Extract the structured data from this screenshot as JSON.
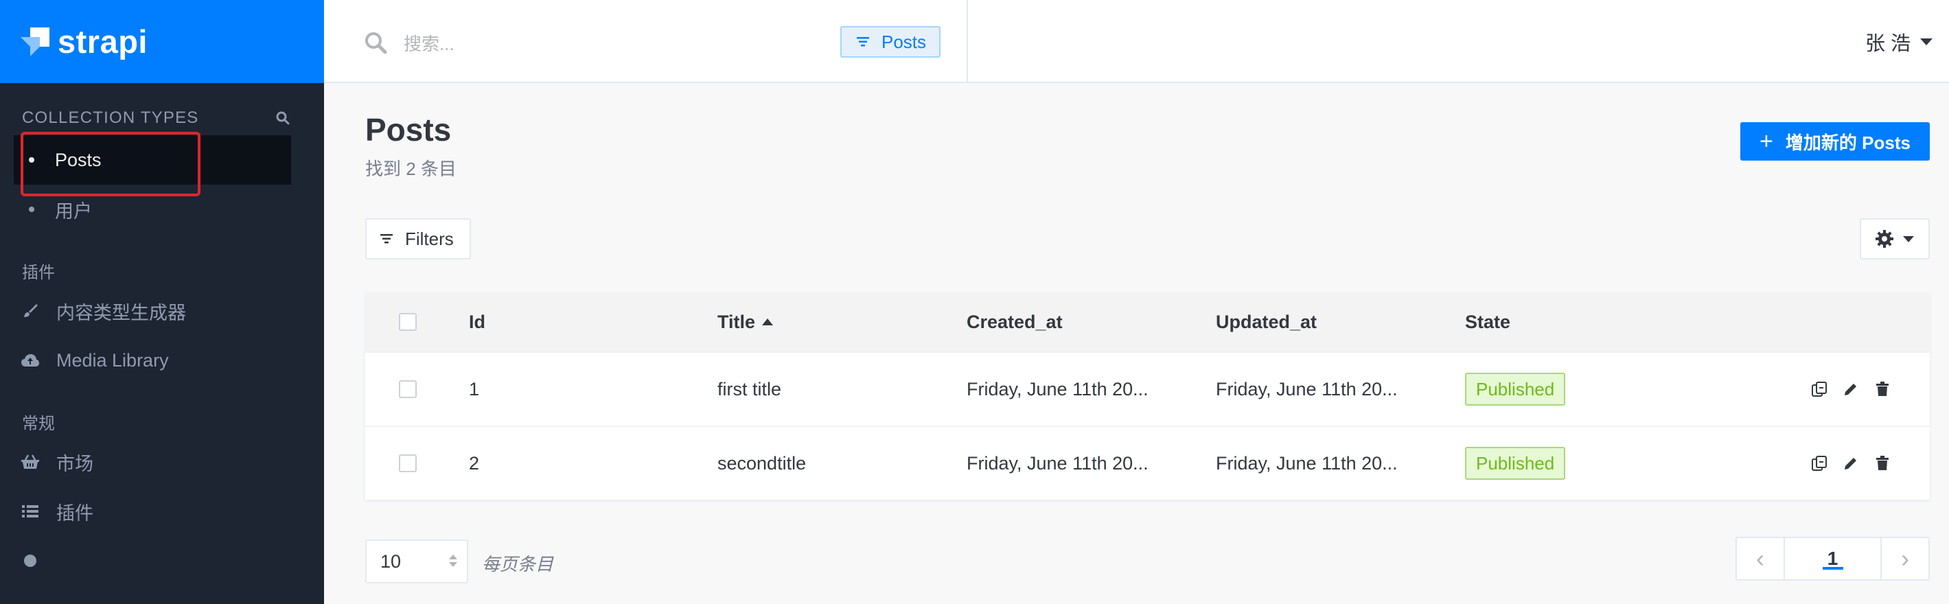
{
  "brand": {
    "name": "strapi"
  },
  "sidebar": {
    "collection_types_heading": "COLLECTION TYPES",
    "collection_items": [
      {
        "label": "Posts",
        "active": true
      },
      {
        "label": "用户",
        "active": false
      }
    ],
    "plugins_heading": "插件",
    "plugin_items": [
      {
        "label": "内容类型生成器",
        "icon": "brush-icon"
      },
      {
        "label": "Media Library",
        "icon": "cloud-upload-icon"
      }
    ],
    "general_heading": "常规",
    "general_items": [
      {
        "label": "市场",
        "icon": "shopping-basket-icon"
      },
      {
        "label": "插件",
        "icon": "list-icon"
      }
    ]
  },
  "header": {
    "search_placeholder": "搜索...",
    "filter_chip": "Posts",
    "user": "张 浩"
  },
  "main": {
    "title": "Posts",
    "subtitle": "找到 2 条目",
    "add_button": "增加新的 Posts",
    "filters_label": "Filters",
    "columns": [
      "Id",
      "Title",
      "Created_at",
      "Updated_at",
      "State"
    ],
    "rows": [
      {
        "id": "1",
        "title": "first title",
        "created_at": "Friday, June 11th 20...",
        "updated_at": "Friday, June 11th 20...",
        "state": "Published"
      },
      {
        "id": "2",
        "title": "secondtitle",
        "created_at": "Friday, June 11th 20...",
        "updated_at": "Friday, June 11th 20...",
        "state": "Published"
      }
    ],
    "per_page_value": "10",
    "per_page_label": "每页条目",
    "current_page": "1"
  },
  "colors": {
    "accent": "#007eff",
    "sidebar_bg": "#1d2533",
    "published_text": "#6dbb1a",
    "published_bg": "#e6f8d4"
  }
}
